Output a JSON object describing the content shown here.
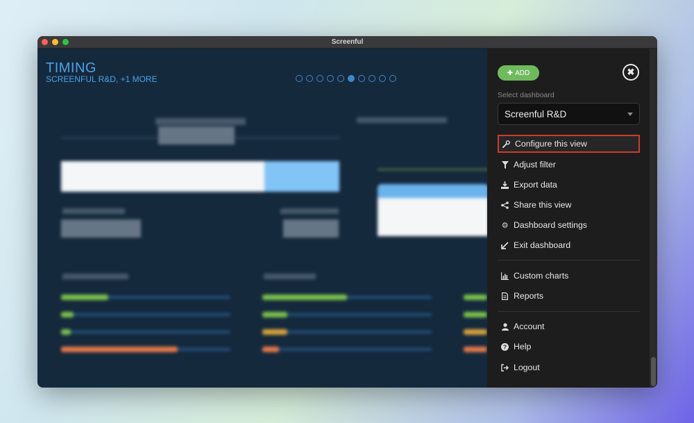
{
  "window": {
    "title": "Screenful"
  },
  "dashboard": {
    "title": "TIMING",
    "subtitle": "SCREENFUL R&D, +1 MORE",
    "pager": {
      "count": 10,
      "active_index": 5
    }
  },
  "sidebar": {
    "add_label": "ADD",
    "close_icon": "close-icon",
    "select_label": "Select dashboard",
    "selected_dashboard": "Screenful R&D",
    "menu_group_1": [
      {
        "label": "Configure this view",
        "icon": "wrench-icon"
      },
      {
        "label": "Adjust filter",
        "icon": "filter-icon"
      },
      {
        "label": "Export data",
        "icon": "download-icon"
      },
      {
        "label": "Share this view",
        "icon": "share-icon"
      },
      {
        "label": "Dashboard settings",
        "icon": "gear-icon"
      },
      {
        "label": "Exit dashboard",
        "icon": "exit-arrow-icon"
      }
    ],
    "menu_group_2": [
      {
        "label": "Custom charts",
        "icon": "bar-chart-icon"
      },
      {
        "label": "Reports",
        "icon": "document-icon"
      }
    ],
    "menu_group_3": [
      {
        "label": "Account",
        "icon": "user-icon"
      },
      {
        "label": "Help",
        "icon": "help-icon"
      },
      {
        "label": "Logout",
        "icon": "logout-icon"
      }
    ]
  },
  "colors": {
    "accent_blue": "#4aa3e8",
    "add_green": "#6fba5c",
    "highlight_red": "#cd3b2c",
    "sidebar_bg": "#1d1d1d",
    "dashboard_bg": "#15293d"
  }
}
